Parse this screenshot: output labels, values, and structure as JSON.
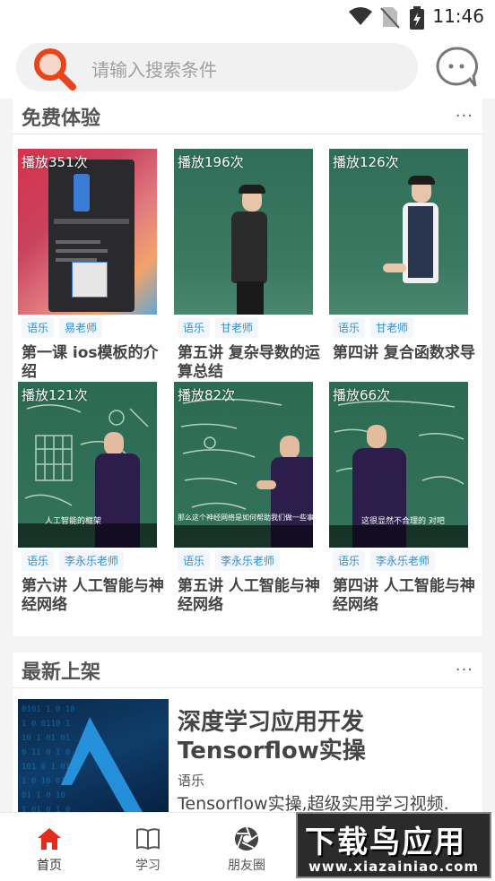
{
  "status_bar": {
    "time": "11:46",
    "icons": [
      "wifi-icon",
      "no-sim-icon",
      "battery-charging-icon"
    ]
  },
  "search": {
    "placeholder": "请输入搜索条件",
    "icon": "search-icon"
  },
  "header": {
    "chat_icon": "chat-bubble-icon"
  },
  "free_trial": {
    "title": "免费体验",
    "more": "...",
    "items": [
      {
        "plays": "播放351次",
        "tags": [
          "语乐",
          "易老师"
        ],
        "title": "第一课 ios模板的介绍"
      },
      {
        "plays": "播放196次",
        "tags": [
          "语乐",
          "甘老师"
        ],
        "title": "第五讲 复杂导数的运算总结"
      },
      {
        "plays": "播放126次",
        "tags": [
          "语乐",
          "甘老师"
        ],
        "title": "第四讲 复合函数求导"
      },
      {
        "plays": "播放121次",
        "tags": [
          "语乐",
          "李永乐老师"
        ],
        "title": "第六讲 人工智能与神经网络",
        "caption": "人工智能的框架"
      },
      {
        "plays": "播放82次",
        "tags": [
          "语乐",
          "李永乐老师"
        ],
        "title": "第五讲 人工智能与神经网络",
        "caption": "那么这个神经网络是如何帮助我们做一些事"
      },
      {
        "plays": "播放66次",
        "tags": [
          "语乐",
          "李永乐老师"
        ],
        "title": "第四讲 人工智能与神经网络",
        "caption": "这很显然不合理的 对吧"
      }
    ]
  },
  "new_arrivals": {
    "title": "最新上架",
    "more": "...",
    "item": {
      "title": "深度学习应用开发Tensorflow实操",
      "tag": "语乐",
      "desc": "Tensorflow实操,超级实用学习视频."
    }
  },
  "bottom_nav": [
    {
      "label": "首页",
      "icon": "home-icon",
      "active": true
    },
    {
      "label": "学习",
      "icon": "book-icon",
      "active": false
    },
    {
      "label": "朋友圈",
      "icon": "aperture-icon",
      "active": false
    }
  ],
  "watermark": {
    "big": "下载鸟应用",
    "small": "www.xiazainiao.com"
  },
  "colors": {
    "accent": "#e8451e",
    "tag_text": "#2f8ed8",
    "board_green": "#2f6b55"
  }
}
